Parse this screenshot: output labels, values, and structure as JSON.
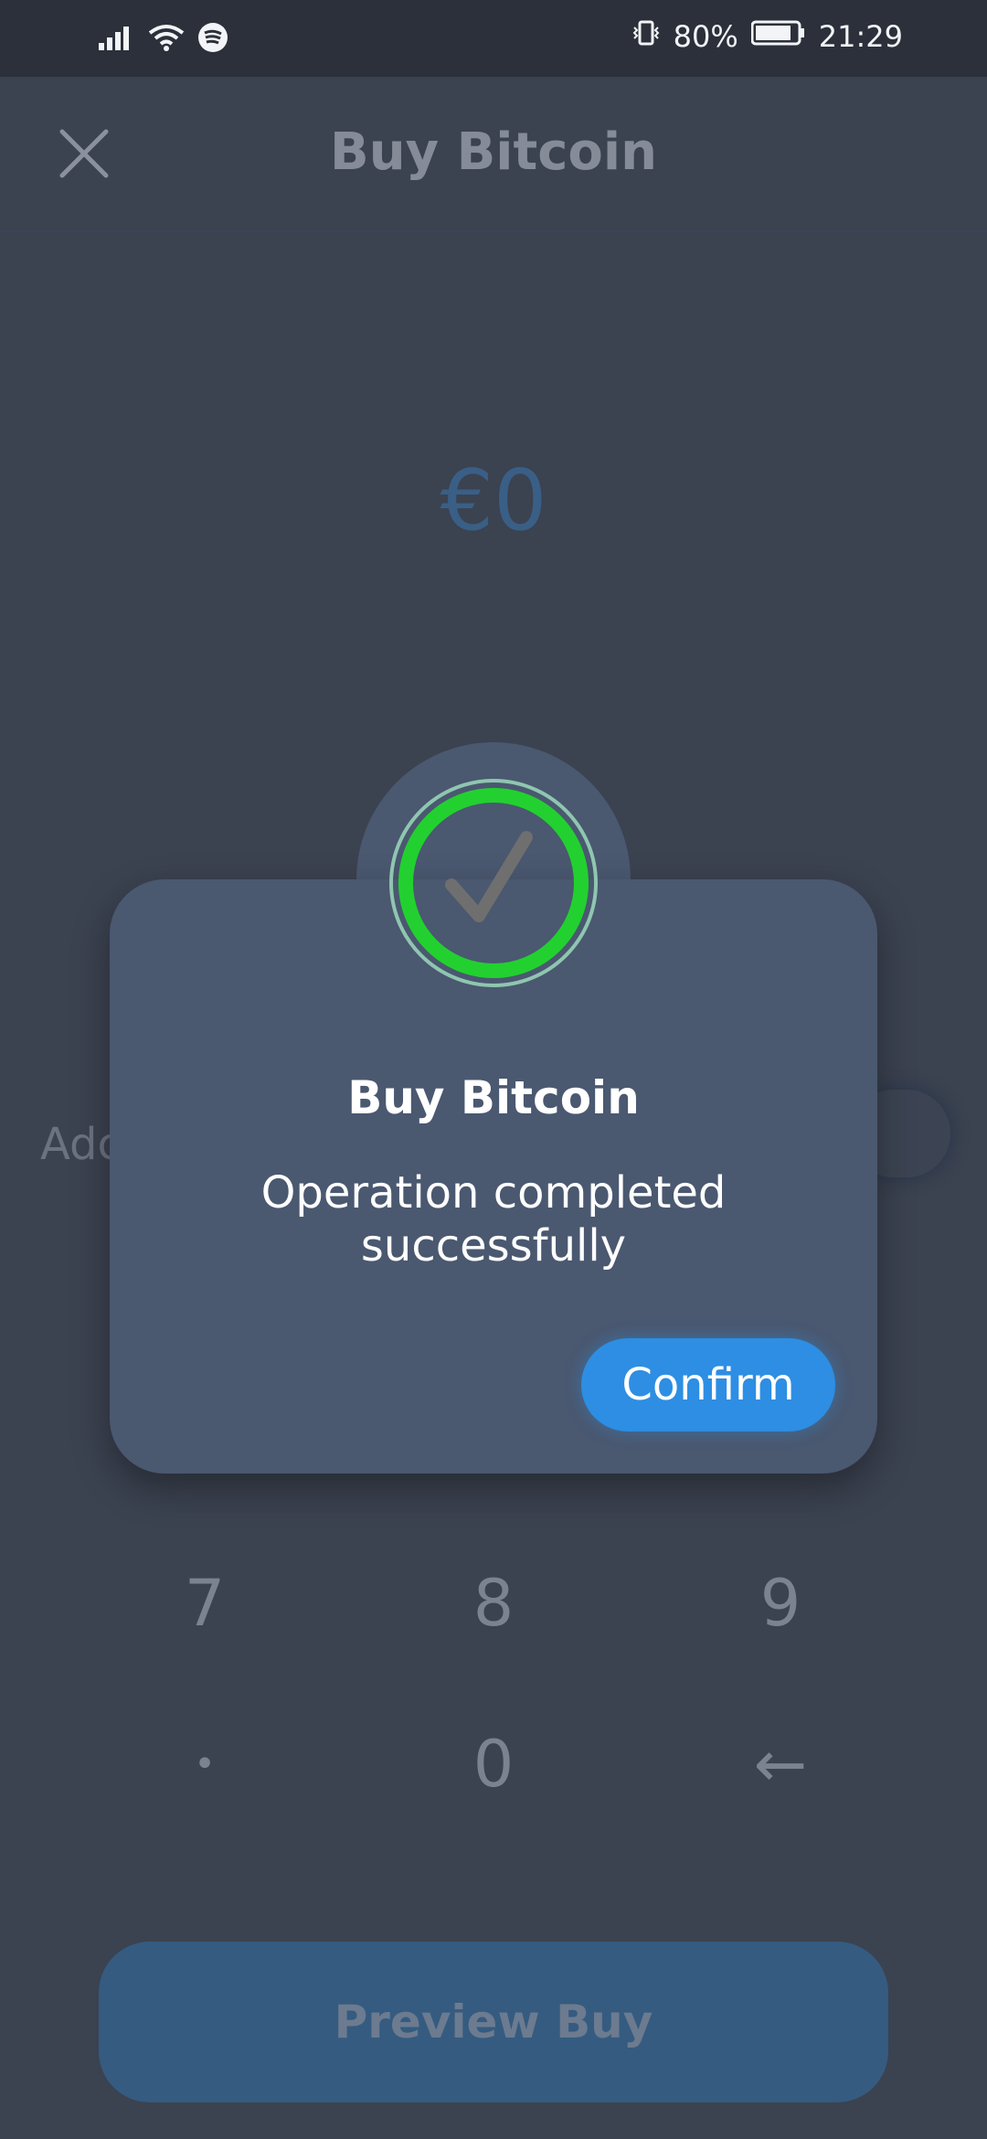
{
  "status_bar": {
    "battery": "80%",
    "time": "21:29",
    "icons": [
      "signal-icon",
      "wifi-icon",
      "spotify-icon",
      "vibrate-icon",
      "battery-icon"
    ]
  },
  "header": {
    "title": "Buy Bitcoin",
    "close_icon": "close-icon"
  },
  "amount": "€0",
  "add_text_fragment": "Adc",
  "keypad": {
    "row1": [
      "7",
      "8",
      "9"
    ],
    "row2": [
      "•",
      "0",
      "←"
    ]
  },
  "preview_button": "Preview Buy",
  "modal": {
    "title": "Buy Bitcoin",
    "message_line1": "Operation completed",
    "message_line2": "successfully",
    "confirm_label": "Confirm",
    "accent_green": "#22d12f",
    "accent_blue": "#2d8ee3"
  }
}
